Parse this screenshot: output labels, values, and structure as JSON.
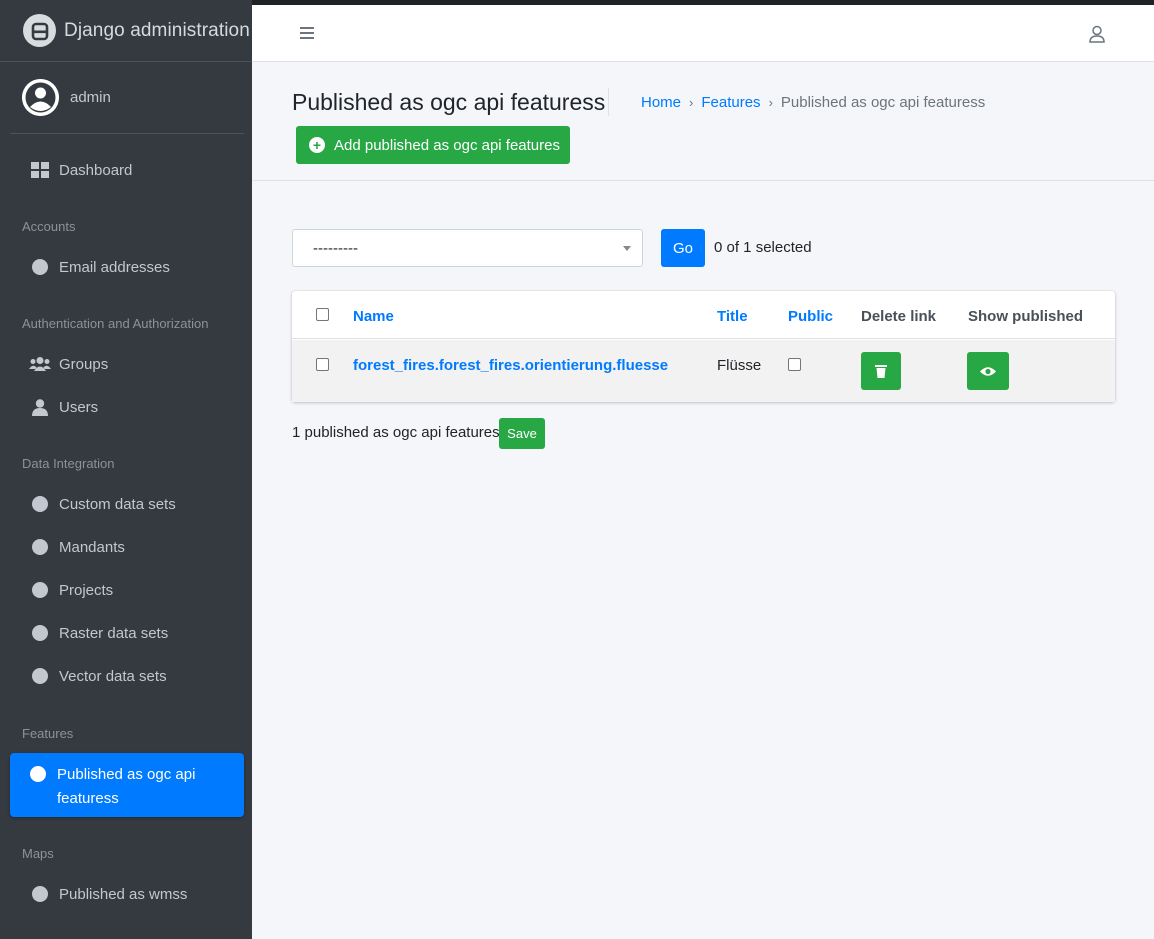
{
  "brand": {
    "title": "Django administration",
    "icon": "django-logo-icon"
  },
  "user": {
    "name": "admin"
  },
  "sidebar": {
    "dashboard": "Dashboard",
    "sections": [
      {
        "header": "Accounts",
        "items": [
          "Email addresses"
        ]
      },
      {
        "header": "Authentication and Authorization",
        "items": [
          "Groups",
          "Users"
        ]
      },
      {
        "header": "Data Integration",
        "items": [
          "Custom data sets",
          "Mandants",
          "Projects",
          "Raster data sets",
          "Vector data sets"
        ]
      },
      {
        "header": "Features",
        "items": [
          "Published as ogc api featuress"
        ]
      },
      {
        "header": "Maps",
        "items": [
          "Published as wmss"
        ]
      }
    ]
  },
  "page": {
    "title": "Published as ogc api featuress",
    "breadcrumb": [
      "Home",
      "Features",
      "Published as ogc api featuress"
    ],
    "add_button": "Add published as ogc api features"
  },
  "actions": {
    "selected_option": "---------",
    "go_label": "Go",
    "selection_count": "0 of 1 selected"
  },
  "table": {
    "columns": [
      "Name",
      "Title",
      "Public",
      "Delete link",
      "Show published"
    ],
    "rows": [
      {
        "name": "forest_fires.forest_fires.orientierung.fluesse",
        "title": "Flüsse",
        "public": false
      }
    ]
  },
  "footer": {
    "count_text": "1 published as ogc api features",
    "save_label": "Save"
  },
  "colors": {
    "primary": "#007bff",
    "success": "#28a745",
    "sidebar": "#343a40",
    "background": "#f4f6f9"
  }
}
